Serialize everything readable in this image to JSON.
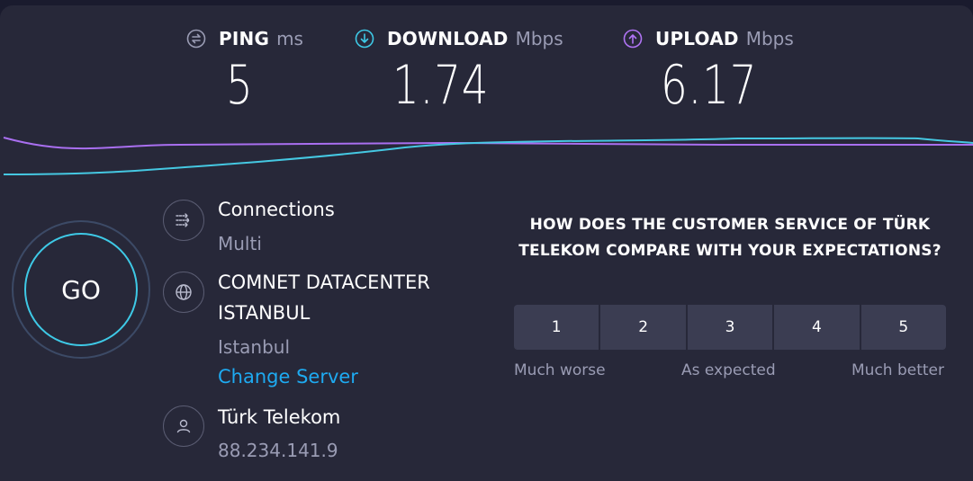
{
  "metrics": {
    "ping": {
      "name": "PING",
      "unit": "ms",
      "value": "5",
      "icon": "ping-icon",
      "color": "#9a9cb4"
    },
    "download": {
      "name": "DOWNLOAD",
      "unit": "Mbps",
      "value": "1.74",
      "icon": "download-arrow-icon",
      "color": "#3ec9e6"
    },
    "upload": {
      "name": "UPLOAD",
      "unit": "Mbps",
      "value": "6.17",
      "icon": "upload-arrow-icon",
      "color": "#b074f5"
    }
  },
  "go_button": {
    "label": "GO"
  },
  "connections": {
    "title": "Connections",
    "value": "Multi",
    "icon": "connections-icon"
  },
  "server": {
    "name_line1": "COMNET DATACENTER",
    "name_line2": "ISTANBUL",
    "location": "Istanbul",
    "change_link": "Change Server",
    "icon": "globe-icon"
  },
  "provider": {
    "name": "Türk Telekom",
    "ip": "88.234.141.9",
    "icon": "user-icon"
  },
  "survey": {
    "question": "HOW DOES THE CUSTOMER SERVICE OF TÜRK TELEKOM COMPARE WITH YOUR EXPECTATIONS?",
    "ratings": [
      "1",
      "2",
      "3",
      "4",
      "5"
    ],
    "label_low": "Much worse",
    "label_mid": "As expected",
    "label_high": "Much better"
  },
  "colors": {
    "accent_download": "#3ec9e6",
    "accent_upload": "#b074f5",
    "link": "#1eaaf1"
  }
}
